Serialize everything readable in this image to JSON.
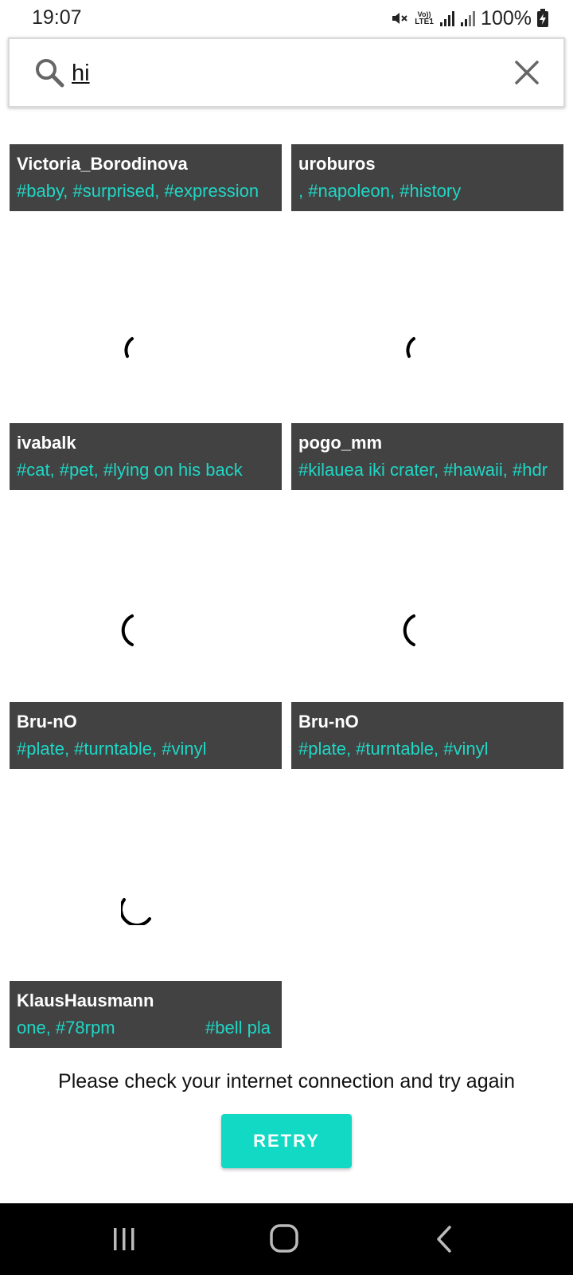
{
  "status_bar": {
    "time": "19:07",
    "network_label": "LTE1",
    "battery": "100%",
    "icons": [
      "mute-icon",
      "volte-icon",
      "signal-icon",
      "signal-icon",
      "battery-charging-icon"
    ]
  },
  "search": {
    "query": "hi",
    "icon": "search-icon",
    "clear_icon": "close-icon"
  },
  "results": [
    {
      "user": "Victoria_Borodinova",
      "tags": "#baby, #surprised, #expression"
    },
    {
      "user": "uroburos",
      "tags": ", #napoleon, #history"
    },
    {
      "user": "ivabalk",
      "tags": "#cat, #pet, #lying on his back"
    },
    {
      "user": "pogo_mm",
      "tags": "#kilauea iki crater, #hawaii, #hdr"
    },
    {
      "user": "Bru-nO",
      "tags": "#plate, #turntable, #vinyl"
    },
    {
      "user": "Bru-nO",
      "tags": "#plate, #turntable, #vinyl"
    },
    {
      "user": "KlausHausmann",
      "tags": "one, #78rpm",
      "tags_extra": "#bell pla"
    }
  ],
  "message": "Please check your internet connection and try again",
  "retry_label": "RETRY",
  "colors": {
    "accent": "#12d9c4",
    "tag_text": "#20d6c5",
    "tile_bar": "#424242",
    "nav_bar": "#000000"
  },
  "nav": {
    "recents_icon": "recents-icon",
    "home_icon": "home-icon",
    "back_icon": "back-icon"
  }
}
